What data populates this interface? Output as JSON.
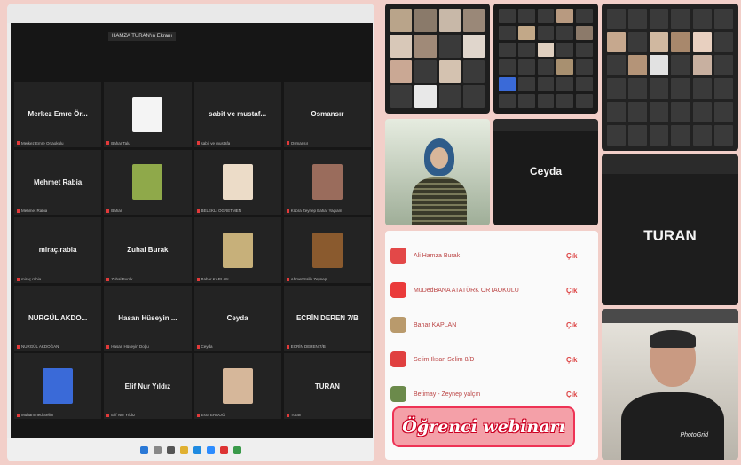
{
  "left_screen": {
    "share_label": "HAMZA TURAN'ın Ekranı",
    "tiles": [
      {
        "name": "Merkez Emre Ör...",
        "caption": "Merkez Emre Ortaokulu"
      },
      {
        "name": "",
        "caption": "Bahar Talu",
        "thumb": "#f4f4f4"
      },
      {
        "name": "sabit ve mustaf...",
        "caption": "sabit ve mustafa"
      },
      {
        "name": "Osmansır",
        "caption": "Osmansır"
      },
      {
        "name": "Mehmet Rabia",
        "caption": "Mehmet Rabia"
      },
      {
        "name": "",
        "caption": "Bahar",
        "thumb": "#8fa94a"
      },
      {
        "name": "",
        "caption": "BELEKLİ ÖĞRETMEN",
        "thumb": "#ecdcc8"
      },
      {
        "name": "",
        "caption": "Kübra Zeynep Bahar Yagiam",
        "thumb": "#9a6c5c"
      },
      {
        "name": "miraç.rabia",
        "caption": "miraç.rabia"
      },
      {
        "name": "Zuhal Burak",
        "caption": "Zuhal Burak"
      },
      {
        "name": "",
        "caption": "Bahar KAPLAN",
        "thumb": "#c7b07a"
      },
      {
        "name": "",
        "caption": "Ahmet Salih Zeynep",
        "thumb": "#8a5a2e"
      },
      {
        "name": "NURGÜL AKDO...",
        "caption": "NURGÜL AKDOĞAN"
      },
      {
        "name": "Hasan Hüseyin ...",
        "caption": "Hasan Hüseyin Doğu"
      },
      {
        "name": "Ceyda",
        "caption": "Ceyda"
      },
      {
        "name": "ECRİN DEREN 7/B",
        "caption": "ECRİN DEREN 7/B"
      },
      {
        "name": "",
        "caption": "Muhammed Selim",
        "thumb": "#3a6ad8"
      },
      {
        "name": "Elif Nur Yıldız",
        "caption": "Elif Nur Yıldız"
      },
      {
        "name": "",
        "caption": "Esra ERDOĞ",
        "thumb": "#d6b79a"
      },
      {
        "name": "TURAN",
        "caption": "Turan"
      }
    ]
  },
  "panels": {
    "ceyda_label": "Ceyda",
    "turan_label": "TURAN",
    "list": [
      {
        "name": "Ali Hamza Burak",
        "status": "Çık",
        "avatar": "#e34848"
      },
      {
        "name": "MuDedBANA ATATÜRK ORTAOKULU",
        "status": "Çık",
        "avatar": "#ea3b3b"
      },
      {
        "name": "Bahar KAPLAN",
        "status": "Çık",
        "avatar": "#b99a6c"
      },
      {
        "name": "Selim Ilısan Selim 8/D",
        "status": "Çık",
        "avatar": "#e04040"
      },
      {
        "name": "Betimay - Zeynep yalçın",
        "status": "Çık",
        "avatar": "#6b8a4b"
      }
    ]
  },
  "banner": {
    "text": "Öğrenci webinarı"
  },
  "watermark": "PhotoGrid",
  "colors": {
    "accent": "#e23a3a",
    "banner_bg": "#f4a0a8"
  }
}
